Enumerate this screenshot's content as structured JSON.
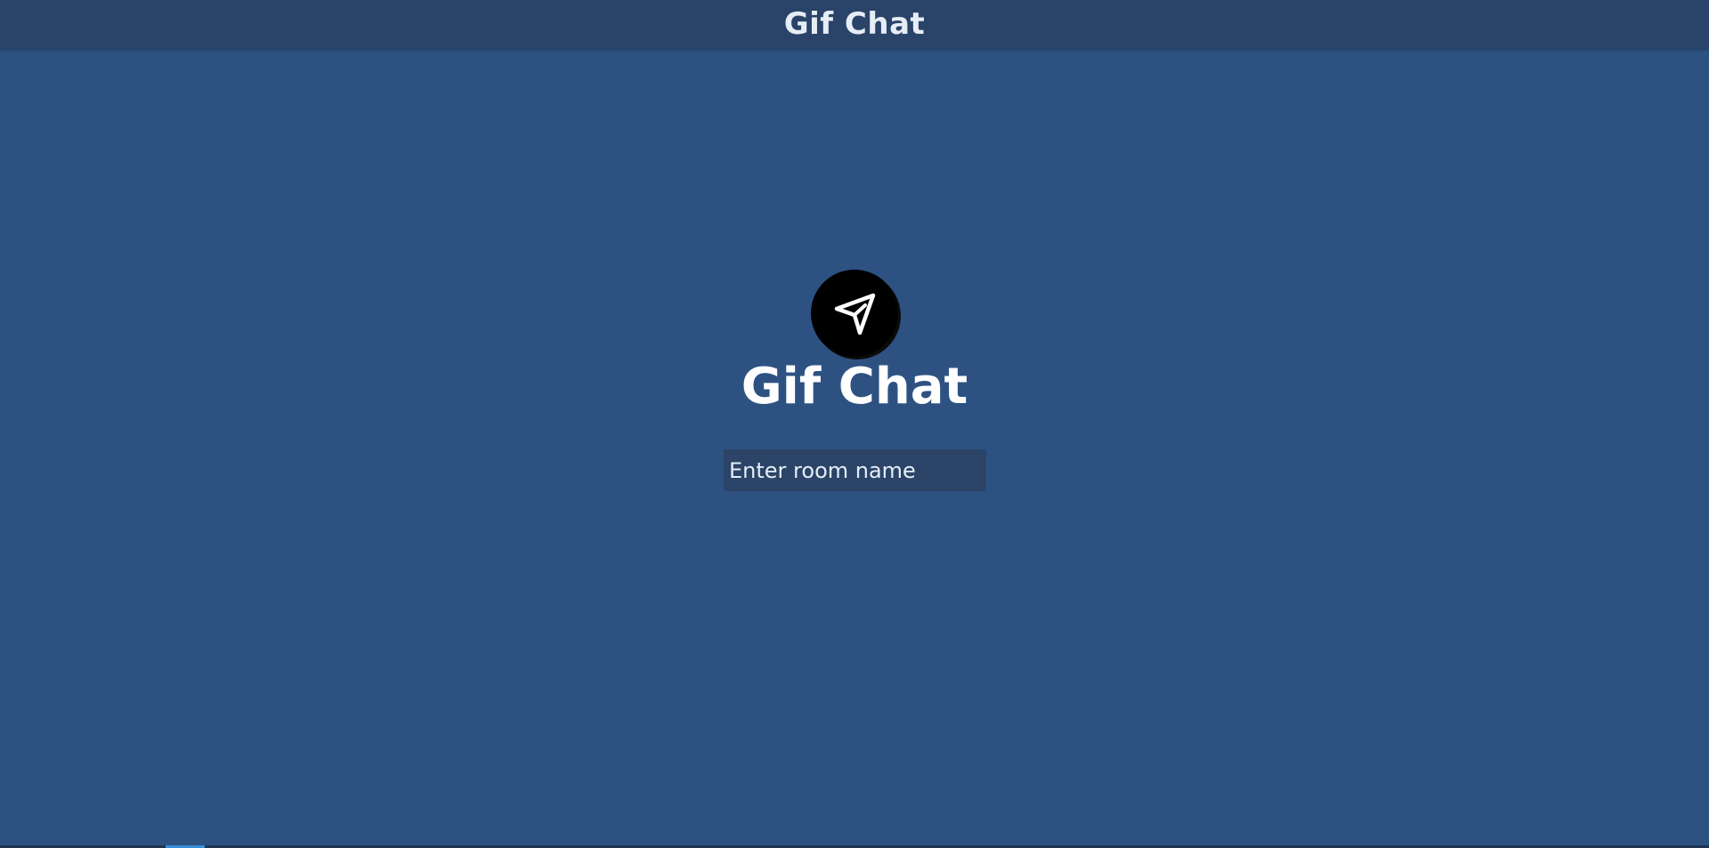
{
  "header": {
    "title": "Gif Chat"
  },
  "logo": {
    "icon": "paper-plane-icon",
    "text": "Gif Chat"
  },
  "room_input": {
    "placeholder": "Enter room name",
    "value": ""
  },
  "colors": {
    "background": "#2d5282",
    "header": "#2a4368",
    "input_background": "#2b4468",
    "text": "#e6edf6"
  }
}
